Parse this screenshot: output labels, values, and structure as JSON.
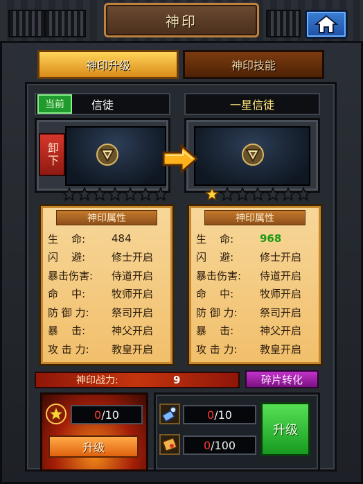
{
  "header": {
    "title": "神印"
  },
  "tabs": [
    {
      "label": "神印升级"
    },
    {
      "label": "神印技能"
    }
  ],
  "current": {
    "badge": "当前",
    "name": "信徒",
    "unequip_label": "卸下",
    "stars_filled": 0,
    "stars_total": 7,
    "attr_title": "神印属性",
    "attrs": [
      {
        "label": "生    命:",
        "value": "484"
      },
      {
        "label": "闪    避:",
        "value": "修士开启"
      },
      {
        "label": "暴击伤害:",
        "value": "侍道开启"
      },
      {
        "label": "命    中:",
        "value": "牧师开启"
      },
      {
        "label": "防 御 力:",
        "value": "祭司开启"
      },
      {
        "label": "暴    击:",
        "value": "神父开启"
      },
      {
        "label": "攻 击 力:",
        "value": "教皇开启"
      }
    ]
  },
  "next": {
    "name": "一星信徒",
    "stars_filled": 1,
    "stars_total": 7,
    "attr_title": "神印属性",
    "attrs": [
      {
        "label": "生    命:",
        "value": "968"
      },
      {
        "label": "闪    避:",
        "value": "修士开启"
      },
      {
        "label": "暴击伤害:",
        "value": "侍道开启"
      },
      {
        "label": "命    中:",
        "value": "牧师开启"
      },
      {
        "label": "防 御 力:",
        "value": "祭司开启"
      },
      {
        "label": "暴    击:",
        "value": "神父开启"
      },
      {
        "label": "攻 击 力:",
        "value": "教皇开启"
      }
    ]
  },
  "power": {
    "label": "神印战力:",
    "value": "9"
  },
  "shard_button": "碎片转化",
  "left_cost": {
    "current": "0",
    "total": "/10",
    "button": "升级"
  },
  "right_cost": [
    {
      "current": "0",
      "total": "/10"
    },
    {
      "current": "0",
      "total": "/100"
    }
  ],
  "upgrade_button": "升级",
  "colors": {
    "highlight_value": "#1b9a12",
    "shortfall": "#ff3a2a"
  }
}
